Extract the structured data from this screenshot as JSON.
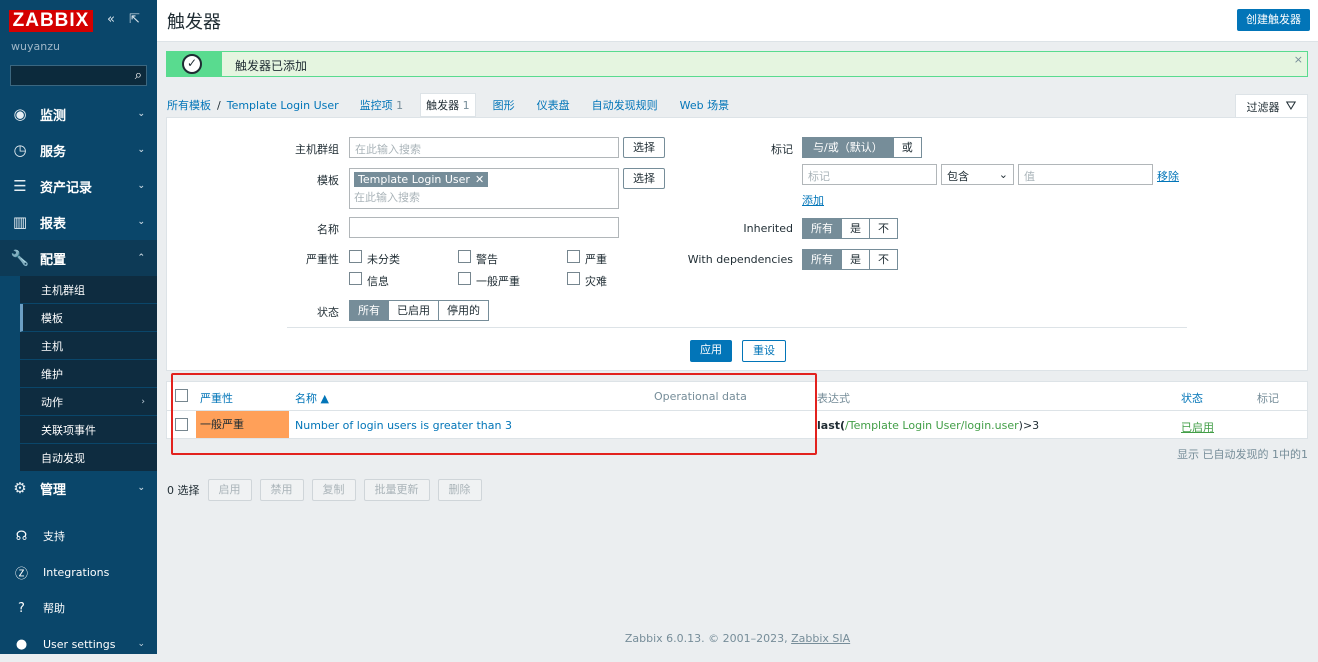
{
  "sidebar": {
    "logo": "ZABBIX",
    "user": "wuyanzu",
    "search_placeholder": "",
    "menu": [
      {
        "label": "监测",
        "icon": "eye-icon"
      },
      {
        "label": "服务",
        "icon": "clock-icon"
      },
      {
        "label": "资产记录",
        "icon": "list-icon"
      },
      {
        "label": "报表",
        "icon": "chart-icon"
      },
      {
        "label": "配置",
        "icon": "wrench-icon"
      },
      {
        "label": "管理",
        "icon": "gear-icon"
      }
    ],
    "submenu": [
      "主机群组",
      "模板",
      "主机",
      "维护",
      "动作",
      "关联项事件",
      "自动发现"
    ],
    "bottom": [
      {
        "label": "支持",
        "icon": "headset-icon"
      },
      {
        "label": "Integrations",
        "icon": "integrations-icon"
      },
      {
        "label": "帮助",
        "icon": "help-icon"
      },
      {
        "label": "User settings",
        "icon": "user-icon"
      }
    ]
  },
  "header": {
    "title": "触发器",
    "create_button": "创建触发器"
  },
  "message": {
    "text": "触发器已添加",
    "close": "×"
  },
  "nav": {
    "all_templates": "所有模板",
    "separator": "/",
    "template": "Template Login User",
    "tabs": [
      {
        "label": "监控项",
        "count": "1"
      },
      {
        "label": "触发器",
        "count": "1"
      },
      {
        "label": "图形",
        "count": ""
      },
      {
        "label": "仪表盘",
        "count": ""
      },
      {
        "label": "自动发现规则",
        "count": ""
      },
      {
        "label": "Web 场景",
        "count": ""
      }
    ]
  },
  "filter": {
    "tab_label": "过滤器",
    "host_group_label": "主机群组",
    "host_group_placeholder": "在此输入搜索",
    "select": "选择",
    "template_label": "模板",
    "template_chip": "Template Login User",
    "template_placeholder": "在此输入搜索",
    "name_label": "名称",
    "severity_label": "严重性",
    "severities": [
      "未分类",
      "警告",
      "严重",
      "信息",
      "一般严重",
      "灾难"
    ],
    "state_label": "状态",
    "state_options": [
      "所有",
      "已启用",
      "停用的"
    ],
    "tags_label": "标记",
    "tags_mode": [
      "与/或（默认）",
      "或"
    ],
    "tag_placeholder": "标记",
    "tag_operator": "包含",
    "tag_value_placeholder": "值",
    "remove": "移除",
    "add": "添加",
    "inherited_label": "Inherited",
    "with_deps_label": "With dependencies",
    "yes_no": [
      "所有",
      "是",
      "不"
    ],
    "apply": "应用",
    "reset": "重设"
  },
  "table": {
    "headers": {
      "severity": "严重性",
      "name": "名称 ▲",
      "opdata": "Operational data",
      "expression": "表达式",
      "status": "状态",
      "tags": "标记"
    },
    "rows": [
      {
        "severity": "一般严重",
        "name": "Number of login users is greater than 3",
        "expr_func": "last(",
        "expr_item": "/Template Login User/login.user",
        "expr_tail": ")>3",
        "status": "已启用"
      }
    ],
    "footer": "显示 已自动发现的 1中的1"
  },
  "actions": {
    "selected": "0 选择",
    "buttons": [
      "启用",
      "禁用",
      "复制",
      "批量更新",
      "删除"
    ]
  },
  "footer": {
    "text": "Zabbix 6.0.13. © 2001–2023, ",
    "link": "Zabbix SIA"
  },
  "colors": {
    "sidebar": "#0a466a",
    "accent": "#0275b8",
    "severity_average": "#ffa059",
    "success": "#59db8f",
    "highlight_box": "#e2221e"
  }
}
